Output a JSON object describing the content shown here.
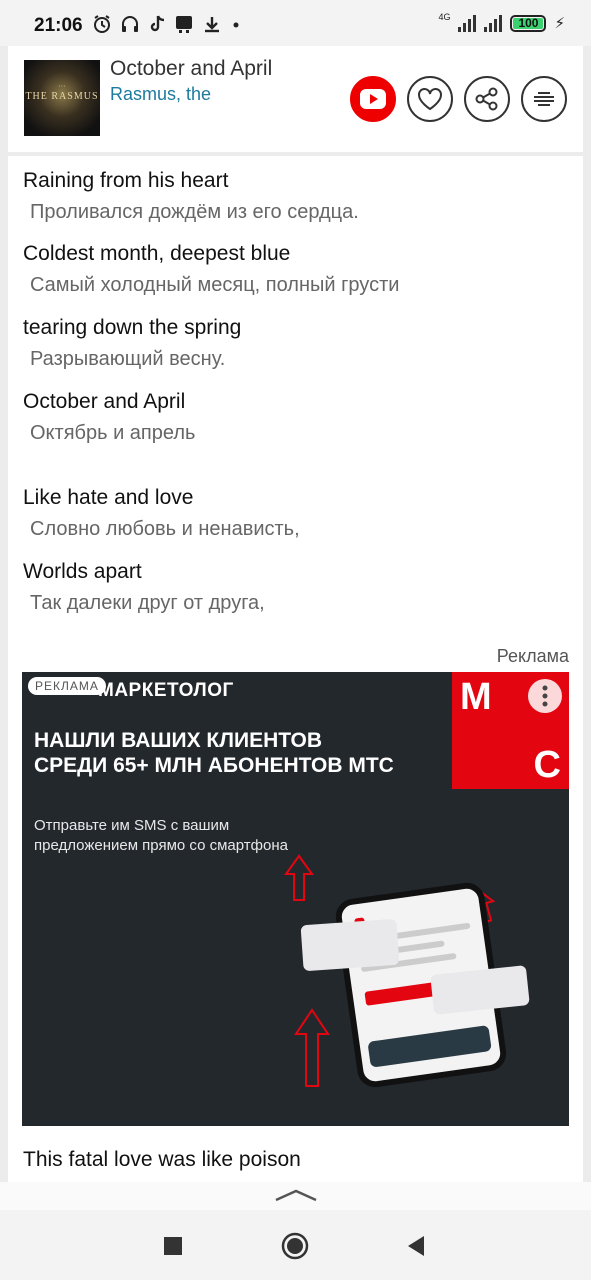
{
  "status_bar": {
    "time": "21:06",
    "network": "4G",
    "battery": "100",
    "icons": [
      "alarm-icon",
      "headphones-icon",
      "tiktok-icon",
      "notification-icon",
      "download-icon",
      "dot-icon"
    ]
  },
  "header": {
    "cover_text": "THE RASMUS",
    "song_title": "October and April",
    "artist": "Rasmus, the",
    "buttons": [
      "youtube-icon",
      "heart-icon",
      "share-icon",
      "menu-icon"
    ],
    "colors": {
      "youtube": "#ee0000",
      "artist_link": "#1d7a9e"
    }
  },
  "lyrics": [
    {
      "en": "Raining from his heart",
      "ru": "Проливался дождём из его сердца."
    },
    {
      "en": "Coldest month, deepest blue",
      "ru": "Самый холодный месяц, полный грусти"
    },
    {
      "en": "tearing down the spring",
      "ru": "Разрывающий весну."
    },
    {
      "en": "October and April",
      "ru": "Октябрь и апрель"
    },
    {
      "en": "Like hate and love",
      "ru": "Словно любовь и ненависть,"
    },
    {
      "en": "Worlds apart",
      "ru": "Так далеки друг от друга,"
    }
  ],
  "ad": {
    "label": "Реклама",
    "tag": "РЕКЛАМА",
    "brand": "МАРКЕТОЛОГ",
    "headline": "НАШЛИ ВАШИХ КЛИЕНТОВ СРЕДИ 65+ МЛН АБОНЕНТОВ МТС",
    "subtext": "Отправьте им SMS с вашим предложением прямо со смартфона",
    "logo_letters": [
      "М",
      "С"
    ],
    "colors": {
      "background": "#23282d",
      "brand_red": "#e30611"
    }
  },
  "lyrics_after_ad": "This fatal love was like poison",
  "nav": [
    "stop-icon",
    "home-icon",
    "back-icon"
  ]
}
